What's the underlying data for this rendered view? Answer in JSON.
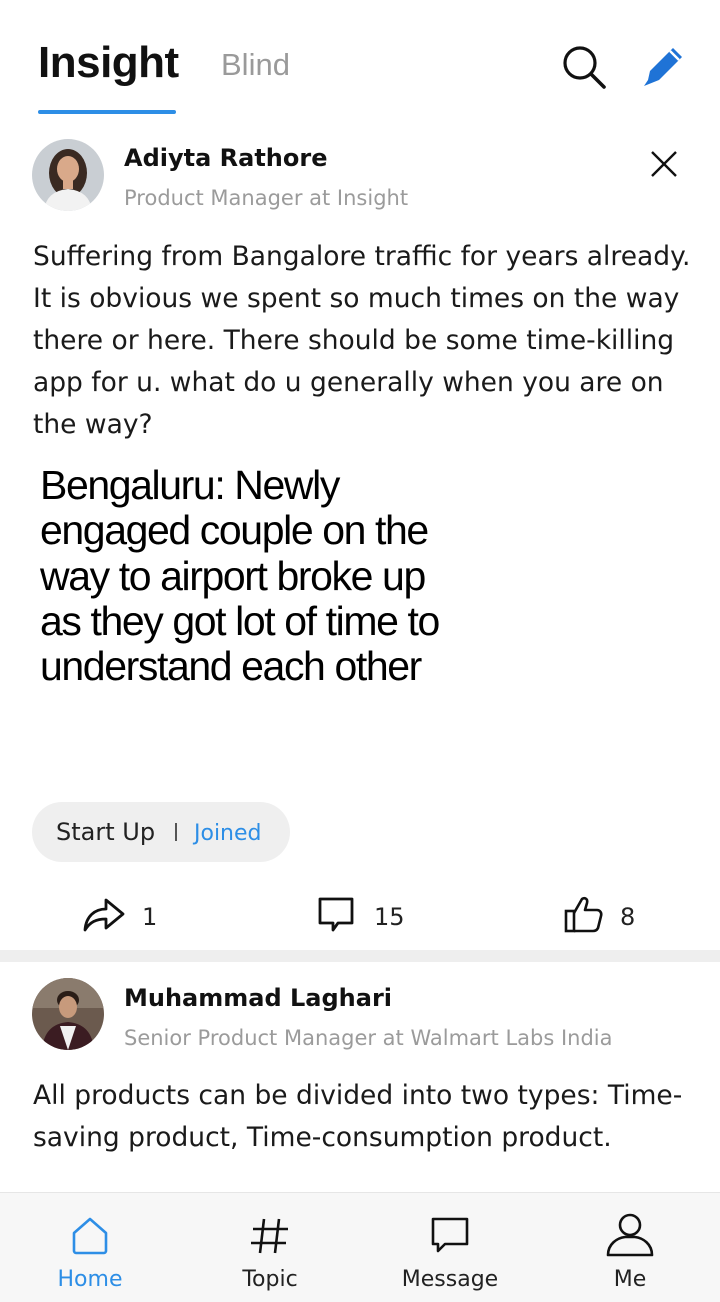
{
  "colors": {
    "accent": "#2d8ee6",
    "muted_text": "#9b9b9b",
    "chip_bg": "#efefef",
    "divider": "#eeeeee",
    "nav_bg": "#f7f7f7"
  },
  "header": {
    "tabs": [
      {
        "label": "Insight",
        "active": true
      },
      {
        "label": "Blind",
        "active": false
      }
    ],
    "icons": [
      "search-icon",
      "compose-icon"
    ]
  },
  "posts": [
    {
      "author": "Adiyta Rathore",
      "role": "Product Manager at Insight",
      "text": "Suffering from Bangalore traffic for years already. It is obvious we spent so much times on the way there or here. There should be some time-killing app for u. what do u generally when you are on the way?",
      "image_headline": "Bengaluru: Newly engaged couple on the way to airport broke up as they got lot of time to understand each other",
      "channel": {
        "name": "Start Up",
        "status": "Joined"
      },
      "actions": {
        "shares": "1",
        "comments": "15",
        "likes": "8"
      }
    },
    {
      "author": "Muhammad Laghari",
      "role": "Senior Product Manager at Walmart Labs India",
      "text": "All products can be divided into two types: Time-saving product, Time-consumption product."
    }
  ],
  "bottom_nav": [
    {
      "label": "Home",
      "icon": "home-icon",
      "active": true
    },
    {
      "label": "Topic",
      "icon": "hashtag-icon",
      "active": false
    },
    {
      "label": "Message",
      "icon": "message-icon",
      "active": false
    },
    {
      "label": "Me",
      "icon": "user-icon",
      "active": false
    }
  ]
}
